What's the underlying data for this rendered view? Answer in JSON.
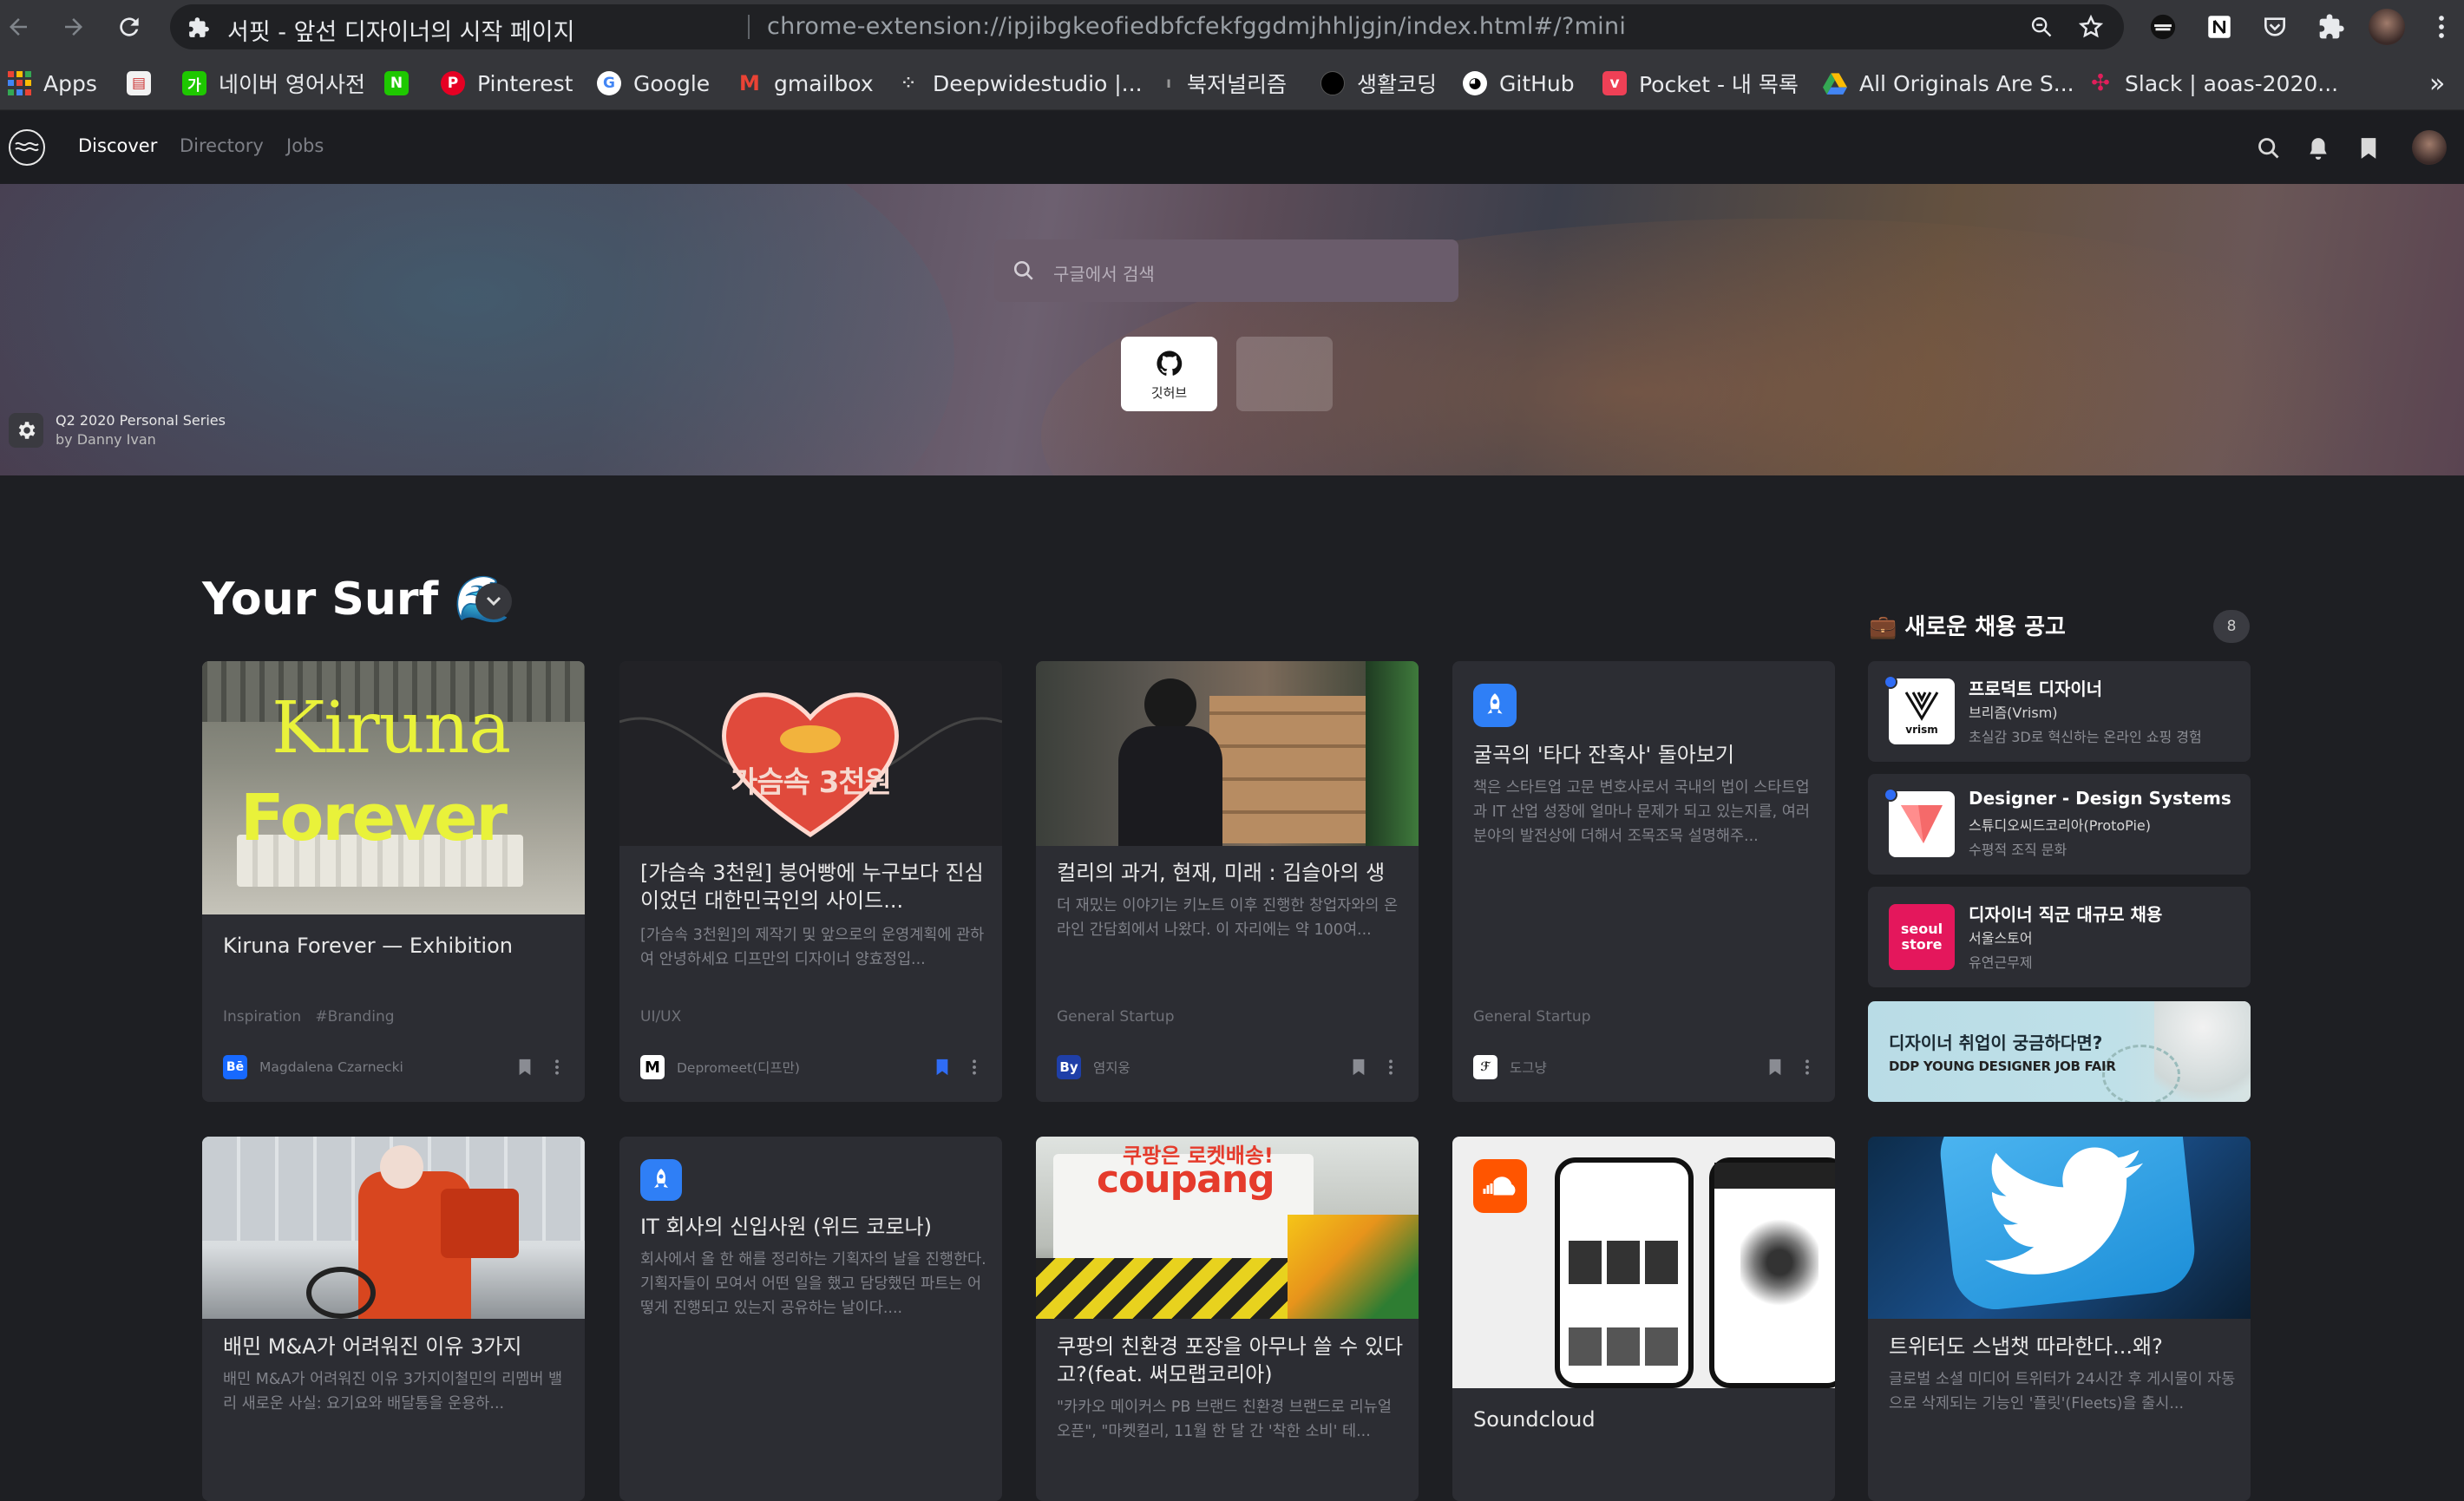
{
  "browser": {
    "tab_title": "서핏 - 앞선 디자이너의 시작 페이지",
    "url": "chrome-extension://ipjibgkeofiedbfcfekfggdmjhhljgjn/index.html#/?mini",
    "bookmarks": [
      "Apps",
      "네이버 영어사전",
      "Pinterest",
      "Google",
      "gmailbox",
      "Deepwidestudio |...",
      "북저널리즘",
      "생활코딩",
      "GitHub",
      "Pocket - 내 목록",
      "All Originals Are S...",
      "Slack | aoas-2020..."
    ],
    "more_bookmarks": "»"
  },
  "nav": {
    "discover": "Discover",
    "directory": "Directory",
    "jobs": "Jobs"
  },
  "hero": {
    "search_placeholder": "구글에서 검색",
    "quick_link_label": "깃허브",
    "credit_title": "Q2 2020 Personal Series",
    "credit_by": "by Danny Ivan"
  },
  "feed": {
    "title": "Your Surf 🌊",
    "cards": [
      {
        "title": "Kiruna Forever — Exhibition",
        "desc": "",
        "tags": "Inspiration   #Branding",
        "source": "Magdalena Czarnecki",
        "image_text_1": "Kiruna",
        "image_text_2": "Forever"
      },
      {
        "title": "[가슴속 3천원] 붕어빵에 누구보다 진심이었던 대한민국인의 사이드...",
        "desc": "[가슴속 3천원]의 제작기 및 앞으로의 운영계획에 관하여 안녕하세요 디프만의 디자이너 양효정입...",
        "tags": "UI/UX",
        "source": "Depromeet(디프만)",
        "image_text": "가슴속 3천원"
      },
      {
        "title": "컬리의 과거, 현재, 미래 : 김슬아의 생각",
        "desc": "더 재밌는 이야기는 키노트 이후 진행한 창업자와의 온라인 간담회에서 나왔다. 이 자리에는 약 100여...",
        "tags": "General Startup",
        "source": "염지웅"
      },
      {
        "title": "굴곡의 '타다 잔혹사' 돌아보기",
        "desc": "책은 스타트업 고문 변호사로서 국내의 법이 스타트업과 IT 산업 성장에 얼마나 문제가 되고 있는지를, 여러 분야의 발전상에 더해서 조목조목 설명해주...",
        "tags": "General Startup",
        "source": "도그냥"
      },
      {
        "title": "배민 M&A가 어려워진 이유 3가지",
        "desc": "배민 M&A가 어려워진 이유 3가지이철민의 리멤버 밸리 새로운 사실: 요기요와 배달통을 운용하..."
      },
      {
        "title": "IT 회사의 신입사원 (위드 코로나)",
        "desc": "회사에서 올 한 해를 정리하는 기획자의 날을 진행한다. 기획자들이 모여서 어떤 일을 했고 담당했던 파트는 어떻게 진행되고 있는지 공유하는 날이다...."
      },
      {
        "title": "쿠팡의 친환경 포장을 아무나 쓸 수 있다고?(feat. 써모랩코리아)",
        "desc": "\"카카오 메이커스 PB 브랜드 친환경 브랜드로 리뉴얼 오픈\", \"마켓컬리, 11월 한 달 간 '착한 소비' 테...",
        "image_text_1": "쿠팡은 로켓배송!",
        "image_text_2": "coupang"
      },
      {
        "title": "Soundcloud",
        "desc": ""
      },
      {
        "title": "트위터도 스냅챗 따라한다...왜?",
        "desc": "글로벌 소셜 미디어 트위터가 24시간 후 게시물이 자동으로 삭제되는 기능인 '플릿'(Fleets)을 출시..."
      }
    ]
  },
  "jobs": {
    "title": "💼 새로운 채용 공고",
    "count": "8",
    "items": [
      {
        "title": "프로덕트 디자이너",
        "company": "브리즘(Vrism)",
        "summary": "초실감 3D로 혁신하는 온라인 쇼핑 경험",
        "logo_text": "vrism"
      },
      {
        "title": "Designer - Design Systems",
        "company": "스튜디오씨드코리아(ProtoPie)",
        "summary": "수평적 조직 문화"
      },
      {
        "title": "디자이너 직군 대규모 채용",
        "company": "서울스토어",
        "summary": "유연근무제",
        "logo_text_1": "seoul",
        "logo_text_2": "store"
      }
    ],
    "ad_title": "디자이너 취업이 궁금하다면?",
    "ad_subtitle": "DDP YOUNG DESIGNER JOB FAIR"
  },
  "colors": {
    "accent": "#2f6cf5",
    "card": "#2c2d33",
    "bg": "#1e1f23"
  }
}
